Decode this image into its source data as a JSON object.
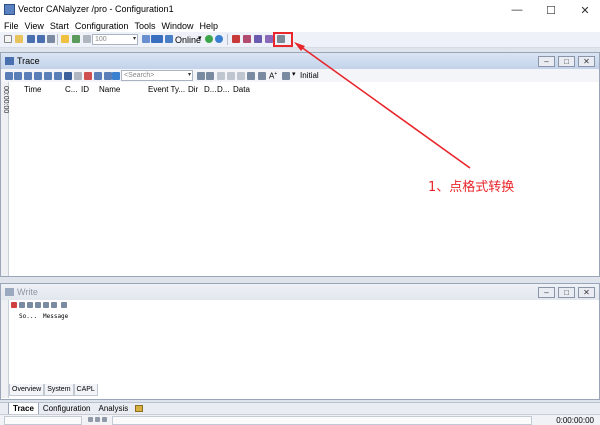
{
  "app": {
    "title": "Vector CANalyzer /pro  - Configuration1",
    "caption_buttons": {
      "minimize": "—",
      "maximize": "☐",
      "close": "✕"
    }
  },
  "menu": {
    "items": [
      "File",
      "View",
      "Start",
      "Configuration",
      "Tools",
      "Window",
      "Help"
    ]
  },
  "toolbar": {
    "zoom_value": "100",
    "online_label": "Online",
    "highlighted_tool_icon": "format-conversion-icon"
  },
  "trace": {
    "title": "Trace",
    "search_placeholder": "<Search>",
    "initial_label": "Initial",
    "left_time_label": "00:00:00",
    "columns": [
      "Time",
      "C...",
      "ID",
      "Name",
      "Event Ty...",
      "Dir",
      "D...",
      "D...",
      "Data"
    ]
  },
  "write": {
    "title": "Write",
    "columns": [
      "So...",
      "Message"
    ],
    "tabs": [
      "Overview",
      "System",
      "CAPL"
    ]
  },
  "bottom_tabs": [
    "Trace",
    "Configuration",
    "Analysis"
  ],
  "status": {
    "time": "0:00:00:00"
  },
  "annotation": {
    "text": "1、点格式转换",
    "color": "#e8262b"
  },
  "colors": {
    "accent": "#e8262b",
    "window_title": "#c3d3ea"
  }
}
